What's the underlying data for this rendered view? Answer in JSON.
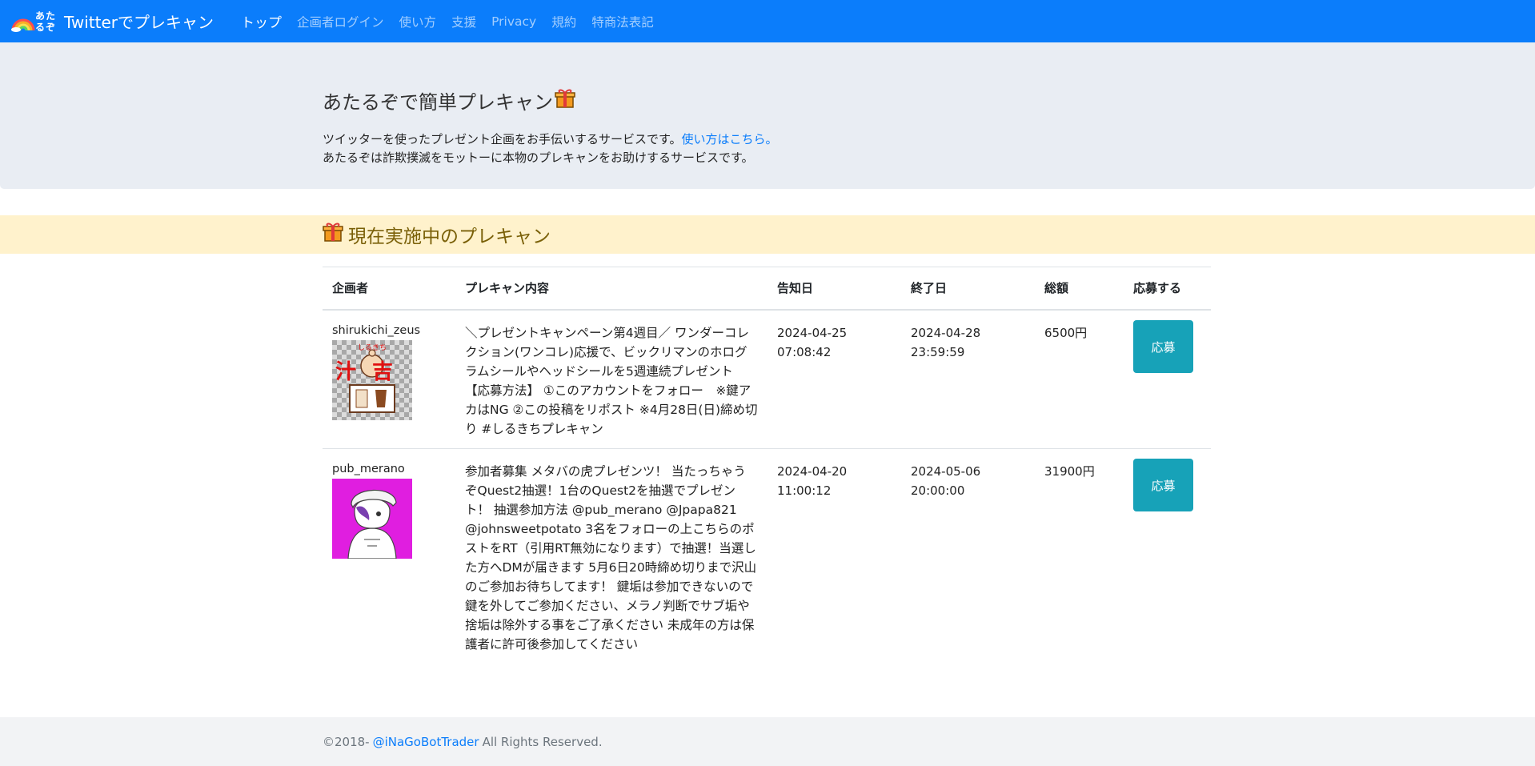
{
  "navbar": {
    "logo_line1": "あた",
    "logo_line2": "るぞ",
    "brand": "Twitterでプレキャン",
    "links": [
      {
        "label": "トップ",
        "active": true
      },
      {
        "label": "企画者ログイン"
      },
      {
        "label": "使い方"
      },
      {
        "label": "支援"
      },
      {
        "label": "Privacy"
      },
      {
        "label": "規約"
      },
      {
        "label": "特商法表記"
      }
    ]
  },
  "hero": {
    "title": "あたるぞで簡単プレキャン",
    "line1": "ツイッターを使ったプレゼント企画をお手伝いするサービスです。",
    "line1_link": "使い方はこちら。",
    "line2": "あたるぞは詐欺撲滅をモットーに本物のプレキャンをお助けするサービスです。"
  },
  "section": {
    "title": "現在実施中のプレキャン"
  },
  "table": {
    "headers": {
      "organizer": "企画者",
      "content": "プレキャン内容",
      "announce": "告知日",
      "end": "終了日",
      "total": "総額",
      "apply": "応募する"
    },
    "rows": [
      {
        "organizer": "shirukichi_zeus",
        "avatar_icon": "shirukichi-avatar-icon",
        "avatar_text": "汁吉",
        "avatar_ruby": "しるきち",
        "content": "＼プレゼントキャンペーン第4週目／ ワンダーコレクション(ワンコレ)応援で、ビックリマンのホログラムシールやヘッドシールを5週連続プレゼント 【応募方法】 ①このアカウントをフォロー　※鍵アカはNG ②この投稿をリポスト ※4月28日(日)締め切り #しるきちプレキャン",
        "announce_date": "2024-04-25",
        "announce_time": "07:08:42",
        "end_date": "2024-04-28",
        "end_time": "23:59:59",
        "total": "6500円",
        "apply_label": "応募"
      },
      {
        "organizer": "pub_merano",
        "avatar_icon": "merano-avatar-icon",
        "content": "参加者募集 メタバの虎プレゼンツ！ 当たっちゃうぞQuest2抽選！1台のQuest2を抽選でプレゼント！ 抽選参加方法 @pub_merano @Jpapa821 @johnsweetpotato 3名をフォローの上こちらのポストをRT（引用RT無効になります）で抽選！当選した方へDMが届きます 5月6日20時締め切りまで沢山のご参加お待ちしてます！ 鍵垢は参加できないので鍵を外してご参加ください、メラノ判断でサブ垢や捨垢は除外する事をご了承ください 未成年の方は保護者に許可後参加してください",
        "announce_date": "2024-04-20",
        "announce_time": "11:00:12",
        "end_date": "2024-05-06",
        "end_time": "20:00:00",
        "total": "31900円",
        "apply_label": "応募"
      }
    ]
  },
  "footer": {
    "copyright": "©2018-",
    "link": "@iNaGoBotTrader",
    "rights": "All Rights Reserved."
  },
  "colors": {
    "navbar": "#0b7dfb",
    "hero_bg": "#e9edf3",
    "banner_bg": "#fff2cc",
    "banner_text": "#7a6008",
    "apply_button": "#17a2b8",
    "footer_bg": "#f2f3f5"
  }
}
